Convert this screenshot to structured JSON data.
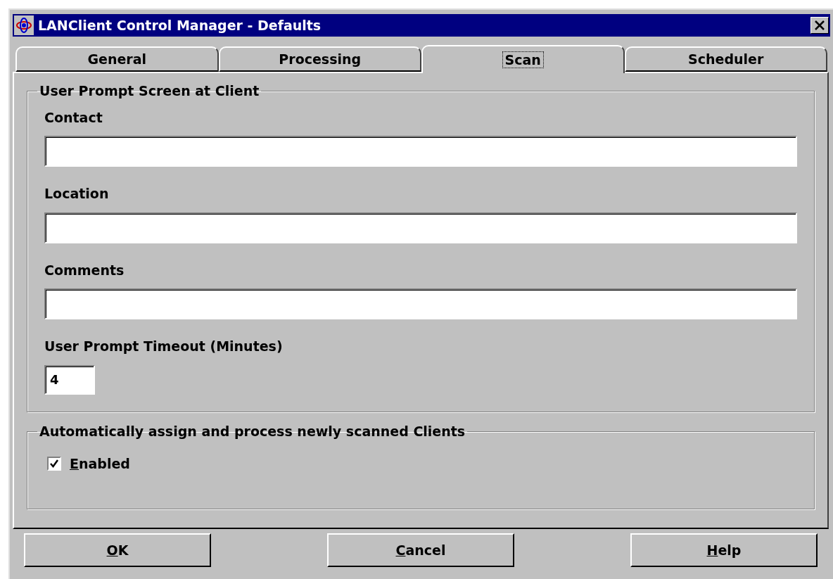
{
  "window": {
    "title": "LANClient Control Manager - Defaults"
  },
  "tabs": [
    {
      "label": "General",
      "selected": false
    },
    {
      "label": "Processing",
      "selected": false
    },
    {
      "label": "Scan",
      "selected": true
    },
    {
      "label": "Scheduler",
      "selected": false
    }
  ],
  "user_prompt_group": {
    "title": "User Prompt Screen at Client",
    "fields": [
      {
        "label": "Contact",
        "kind": "wide"
      },
      {
        "label": "Location",
        "kind": "wide"
      },
      {
        "label": "Comments",
        "kind": "wide"
      },
      {
        "label": "User Prompt Timeout (Minutes)",
        "value": "4",
        "kind": "narrow"
      }
    ]
  },
  "auto_assign_group": {
    "title": "Automatically assign and process newly scanned Clients",
    "checkbox": {
      "mnemonic": "E",
      "rest": "nabled",
      "checked": true
    }
  },
  "buttons": [
    {
      "mnemonic": "O",
      "rest": "K"
    },
    {
      "mnemonic": "C",
      "rest": "ancel"
    },
    {
      "mnemonic": "H",
      "rest": "elp"
    }
  ]
}
